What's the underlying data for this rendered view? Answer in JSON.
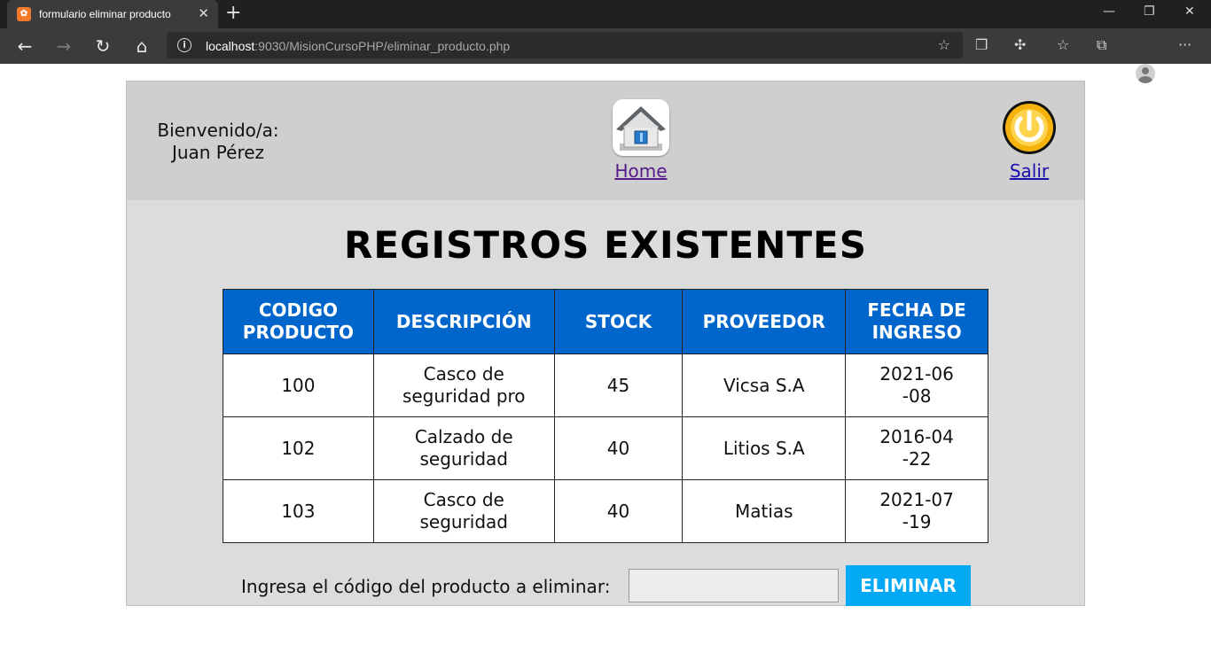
{
  "browser": {
    "tab_title": "formulario eliminar producto",
    "tab_close": "✕",
    "new_tab": "+",
    "url_host": "localhost",
    "url_rest": ":9030/MisionCursoPHP/eliminar_producto.php",
    "window_controls": {
      "minimize": "—",
      "maximize": "❐",
      "close": "✕"
    }
  },
  "header": {
    "welcome_line1": "Bienvenido/a:",
    "welcome_line2": "Juan Pérez",
    "home_label": "Home",
    "logout_label": "Salir"
  },
  "main": {
    "title": "REGISTROS EXISTENTES",
    "columns": [
      "CODIGO PRODUCTO",
      "DESCRIPCIÓN",
      "STOCK",
      "PROVEEDOR",
      "FECHA DE INGRESO"
    ],
    "rows": [
      [
        "100",
        "Casco de seguridad pro",
        "45",
        "Vicsa S.A",
        "2021-06-08"
      ],
      [
        "102",
        "Calzado de seguridad",
        "40",
        "Litios S.A",
        "2016-04-22"
      ],
      [
        "103",
        "Casco de seguridad",
        "40",
        "Matias",
        "2021-07-19"
      ]
    ]
  },
  "delete_form": {
    "label": "Ingresa el código del producto a eliminar:",
    "input_value": "",
    "button_label": "ELIMINAR"
  },
  "colors": {
    "table_header": "#0066cc",
    "button": "#03a9f4",
    "header_bg": "#cfcfcf",
    "page_bg": "#dcdcdc"
  },
  "icons": {
    "home": "home-house-icon",
    "logout": "power-icon"
  }
}
